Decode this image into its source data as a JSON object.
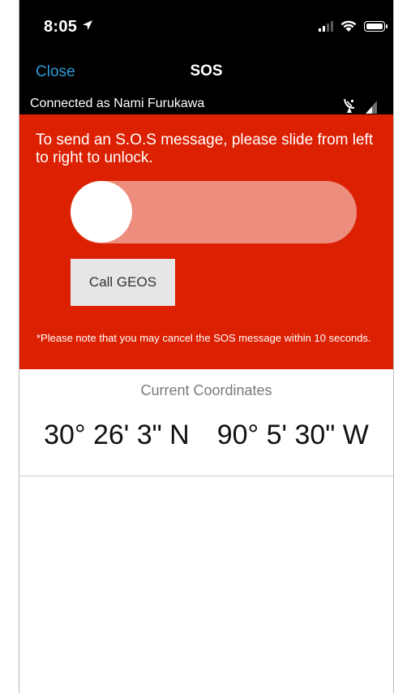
{
  "status_bar": {
    "time": "8:05",
    "signal_bars_filled": 2,
    "signal_bars_total": 4
  },
  "nav": {
    "close_label": "Close",
    "title": "SOS",
    "accent_color": "#2b9cd8"
  },
  "connection": {
    "text": "Connected as Nami Furukawa",
    "icons": [
      "satellite-dish-icon",
      "signal-strength-icon"
    ]
  },
  "sos": {
    "instructions": "To send an S.O.S message, please slide from left to right to unlock.",
    "slider_position": 0,
    "call_button_label": "Call GEOS",
    "note": "*Please note that you may cancel the SOS message within 10 seconds.",
    "panel_color": "#dc2002",
    "track_color": "#ec8d7d"
  },
  "coordinates": {
    "label": "Current Coordinates",
    "latitude": "30° 26' 3\" N",
    "longitude": "90° 5' 30\" W"
  }
}
